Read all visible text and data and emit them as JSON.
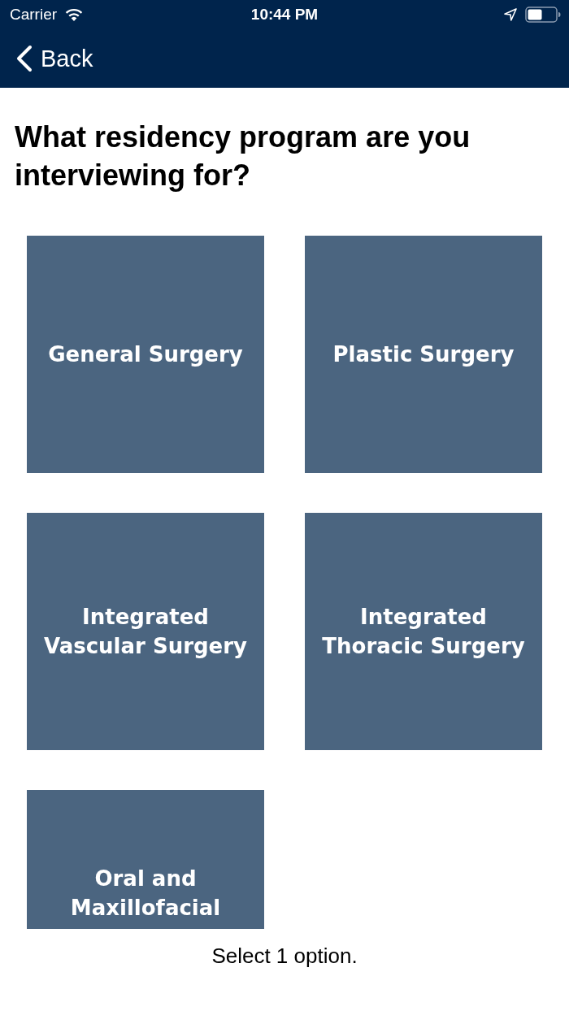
{
  "status_bar": {
    "carrier": "Carrier",
    "time": "10:44 PM"
  },
  "nav_bar": {
    "back_label": "Back"
  },
  "question": "What residency program are you interviewing for?",
  "options": [
    {
      "label": "General Surgery",
      "selected": false
    },
    {
      "label": "Plastic Surgery",
      "selected": false
    },
    {
      "label": "Integrated Vascular Surgery",
      "selected": false
    },
    {
      "label": "Integrated Thoracic Surgery",
      "selected": false
    },
    {
      "label": "Oral and Maxillofacial",
      "selected": false
    }
  ],
  "footer": {
    "hint": "Select 1 option."
  }
}
